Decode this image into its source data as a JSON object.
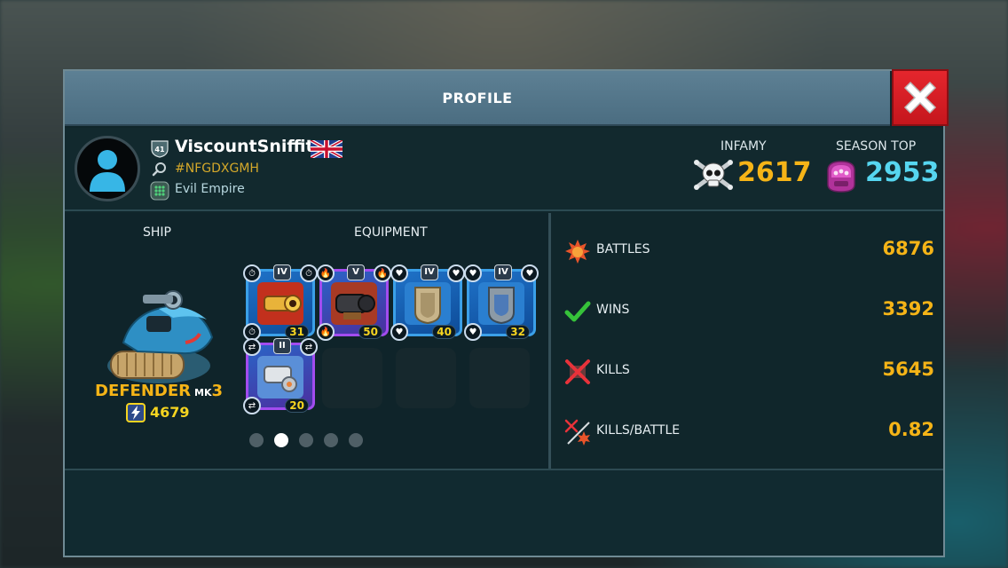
{
  "header": {
    "title": "PROFILE"
  },
  "player": {
    "name": "ViscountSniffit",
    "level": "41",
    "tag": "#NFGDXGMH",
    "guild": "Evil Empire"
  },
  "summary": {
    "infamy_label": "INFAMY",
    "infamy_value": "2617",
    "season_top_label": "SEASON TOP",
    "season_top_value": "2953"
  },
  "loadout": {
    "ship_label": "SHIP",
    "equipment_label": "EQUIPMENT",
    "ship_name": "DEFENDER",
    "ship_mk": "MK",
    "ship_mk_num": "3",
    "ship_power": "4679",
    "equipment": [
      {
        "rank": "IV",
        "level": "31",
        "type": "cannon"
      },
      {
        "rank": "V",
        "level": "50",
        "type": "mortar"
      },
      {
        "rank": "IV",
        "level": "40",
        "type": "armor"
      },
      {
        "rank": "IV",
        "level": "32",
        "type": "shield"
      },
      {
        "rank": "II",
        "level": "20",
        "type": "turret"
      }
    ],
    "pages": 5,
    "active_page": 1
  },
  "stats": [
    {
      "label": "BATTLES",
      "value": "6876",
      "icon": "explosion-icon"
    },
    {
      "label": "WINS",
      "value": "3392",
      "icon": "checkmark-icon"
    },
    {
      "label": "KILLS",
      "value": "5645",
      "icon": "crossed-swords-icon"
    },
    {
      "label": "KILLS/BATTLE",
      "value": "0.82",
      "icon": "kills-per-battle-icon"
    }
  ],
  "colors": {
    "accent_gold": "#f5b417",
    "accent_cyan": "#56d6f0",
    "close_red": "#e5262d",
    "header_blue": "#5d8094"
  }
}
